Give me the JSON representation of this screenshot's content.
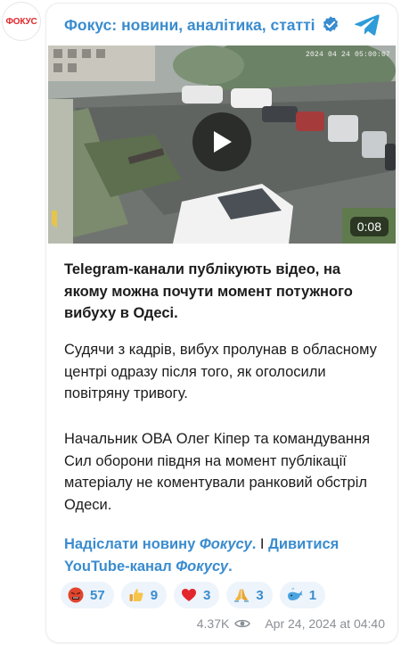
{
  "channel": {
    "avatar_text": "ФОКУС",
    "title": "Фокус: новини, аналітика, статті",
    "verified": true,
    "logo_icon": "telegram-icon"
  },
  "media": {
    "camera_timestamp": "2024 04 24 05:00:07",
    "duration": "0:08",
    "play_icon": "play-icon"
  },
  "post": {
    "paragraph_1": "Telegram-канали публікують відео, на якому можна почути момент потужного вибуху в Одесі.",
    "paragraph_2": "Судячи з кадрів, вибух пролунав в обласному центрі одразу після того, як оголосили повітряну тривогу.",
    "paragraph_3": "Начальник ОВА Олег Кіпер та командування Сил оборони півдня на момент публікації матеріалу не коментували ранковий обстріл Одеси.",
    "link_1_prefix": "Надіслати новину ",
    "link_1_brand": "Фокусу",
    "link_1_suffix": ".",
    "separator": " I ",
    "link_2_prefix": "Дивитися YouTube-канал ",
    "link_2_brand": "Фокусу",
    "link_2_suffix": "."
  },
  "reactions": [
    {
      "emoji": "angry-face",
      "count": "57"
    },
    {
      "emoji": "thumbs-up",
      "count": "9"
    },
    {
      "emoji": "red-heart",
      "count": "3"
    },
    {
      "emoji": "folded-hands",
      "count": "3"
    },
    {
      "emoji": "whale",
      "count": "1"
    }
  ],
  "footer": {
    "views": "4.37K",
    "views_icon": "eye-icon",
    "date": "Apr 24, 2024 at 04:40"
  },
  "colors": {
    "accent": "#3a8ccf",
    "reaction_bg": "#eef4fb",
    "muted": "#8a8f94",
    "brand_red": "#e2262b"
  }
}
